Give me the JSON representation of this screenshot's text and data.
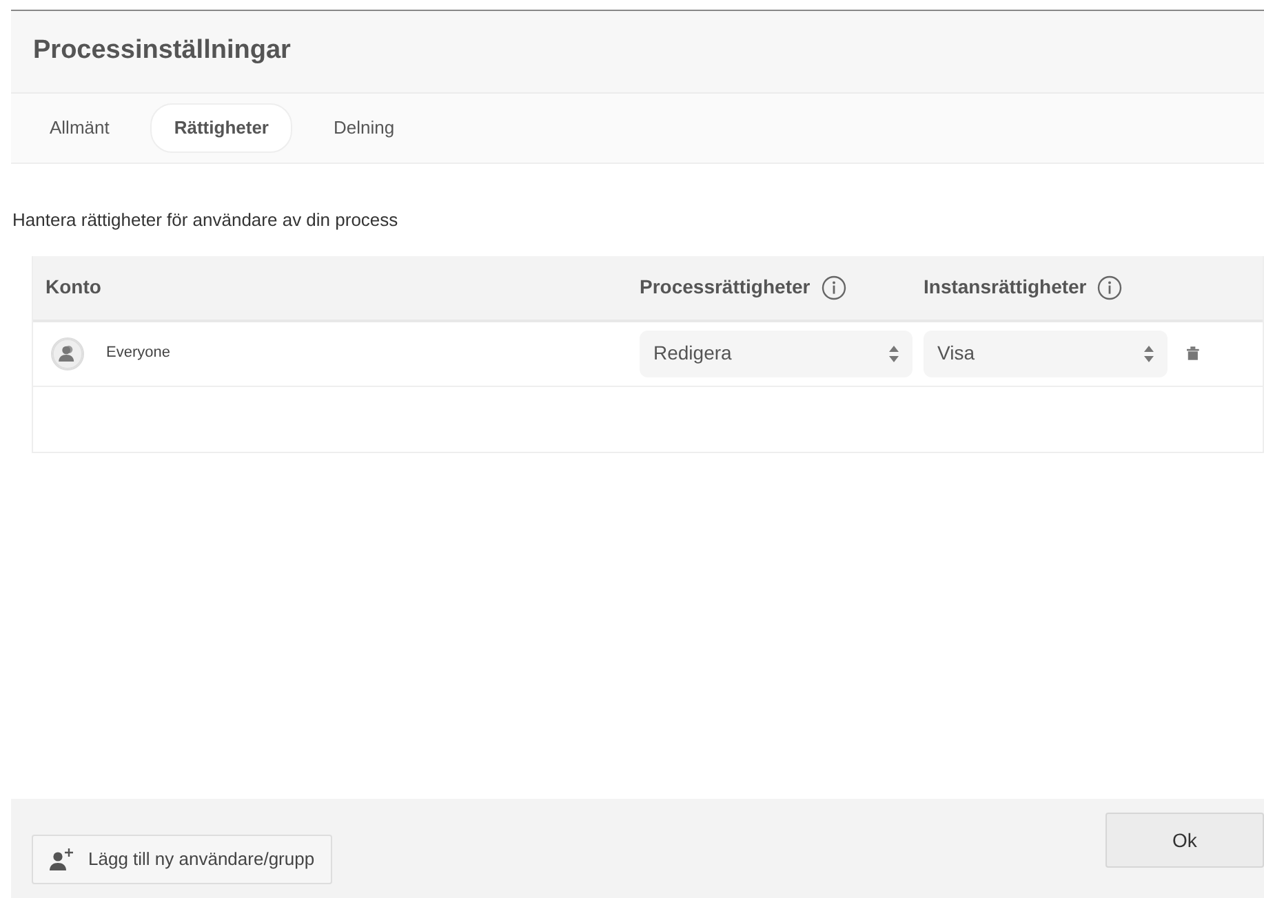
{
  "dialog": {
    "title": "Processinställningar"
  },
  "tabs": [
    {
      "label": "Allmänt",
      "selected": false
    },
    {
      "label": "Rättigheter",
      "selected": true
    },
    {
      "label": "Delning",
      "selected": false
    }
  ],
  "description": "Hantera rättigheter för användare av din process",
  "table": {
    "columns": [
      "Konto",
      "Processrättigheter",
      "Instansrättigheter"
    ],
    "rows": [
      {
        "account": "Everyone",
        "process_rights": "Redigera",
        "instance_rights": "Visa"
      }
    ]
  },
  "footer": {
    "add_button": "Lägg till ny användare/grupp",
    "ok_button": "Ok"
  }
}
